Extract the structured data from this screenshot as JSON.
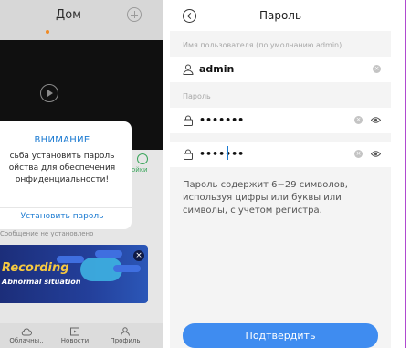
{
  "left": {
    "title": "Дом",
    "side_label": "ойки",
    "alert": {
      "title": "ВНИМАНИЕ",
      "body_line1": "сьба установить пароль",
      "body_line2": "ойства для обеспечения",
      "body_line3": "онфиденциальности!",
      "action": "Установить пароль"
    },
    "message": "Сообщение не установлено",
    "banner": {
      "headline": "Recording",
      "subline": "Abnormal situation",
      "close": "×"
    },
    "tabs": [
      {
        "label": "Облачны..",
        "icon": "cloud-icon"
      },
      {
        "label": "Новости",
        "icon": "news-icon"
      },
      {
        "label": "Профиль",
        "icon": "profile-icon"
      }
    ]
  },
  "right": {
    "title": "Пароль",
    "username_label": "Имя пользователя (по умолчанию admin)",
    "username_value": "admin",
    "password_label": "Пароль",
    "password_value": "•••••••",
    "confirm_value": "•••••••",
    "hint": "Пароль содержит 6−29 символов, используя цифры или буквы или символы, с учетом регистра.",
    "confirm_label": "Подтвердить"
  },
  "colors": {
    "accent": "#3f8cf0",
    "alert_blue": "#1b7ad1",
    "banner_yellow": "#f7c940"
  }
}
